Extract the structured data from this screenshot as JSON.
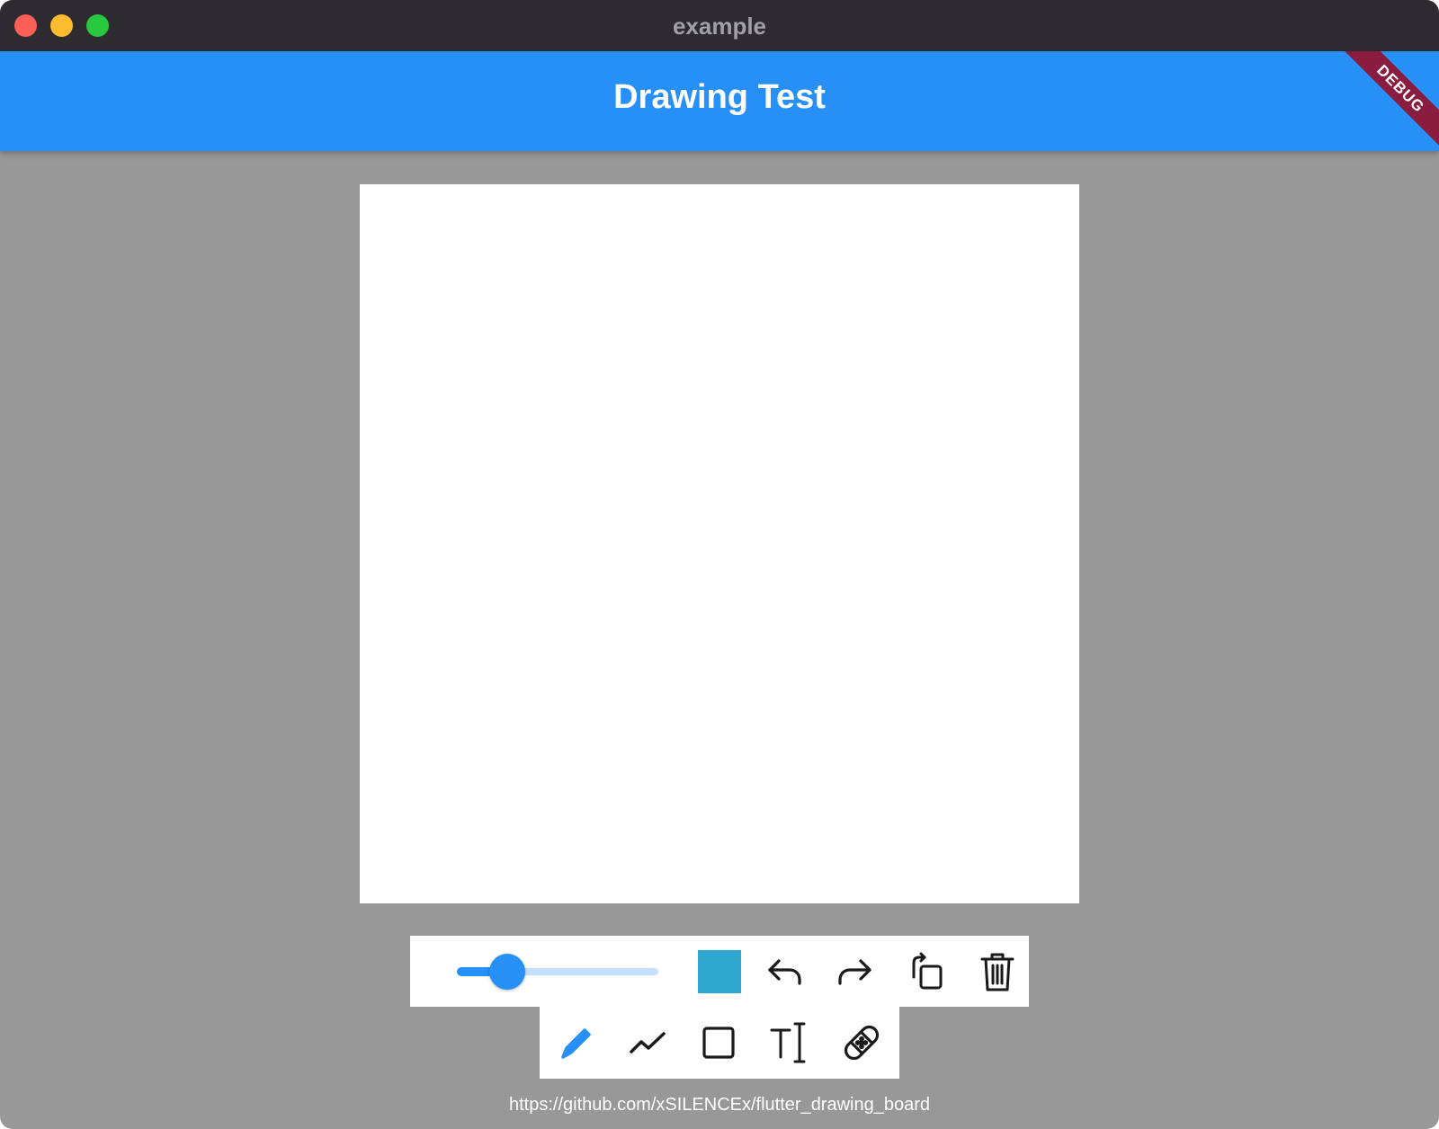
{
  "window": {
    "title": "example"
  },
  "appbar": {
    "title": "Drawing Test",
    "debug_label": "DEBUG",
    "color": "#2790f6"
  },
  "toolbar": {
    "stroke_width_slider": {
      "value_fraction": 0.25
    },
    "selected_color": "#2ea7cf",
    "actions": [
      {
        "name": "undo",
        "icon": "undo-arrow-icon"
      },
      {
        "name": "redo",
        "icon": "redo-arrow-icon"
      },
      {
        "name": "rotate",
        "icon": "rotate-icon"
      },
      {
        "name": "clear",
        "icon": "trash-icon"
      }
    ],
    "tools": [
      {
        "name": "pen",
        "icon": "pencil-icon",
        "selected": true
      },
      {
        "name": "straight-line",
        "icon": "polyline-icon",
        "selected": false
      },
      {
        "name": "rectangle",
        "icon": "rectangle-icon",
        "selected": false
      },
      {
        "name": "text",
        "icon": "text-cursor-icon",
        "selected": false
      },
      {
        "name": "eraser",
        "icon": "bandage-icon",
        "selected": false
      }
    ],
    "active_tool_color": "#2790f6",
    "icon_color": "#1a1a1a"
  },
  "footer": {
    "url": "https://github.com/xSILENCEx/flutter_drawing_board"
  }
}
